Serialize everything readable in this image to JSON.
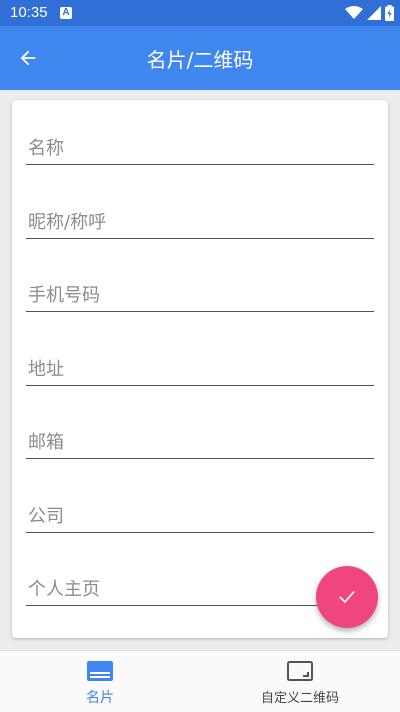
{
  "status_bar": {
    "time": "10:35",
    "notification_letter": "A"
  },
  "app_bar": {
    "title": "名片/二维码",
    "back_icon": "arrow-left-icon"
  },
  "form": {
    "fields": [
      {
        "placeholder": "名称"
      },
      {
        "placeholder": "昵称/称呼"
      },
      {
        "placeholder": "手机号码"
      },
      {
        "placeholder": "地址"
      },
      {
        "placeholder": "邮箱"
      },
      {
        "placeholder": "公司"
      },
      {
        "placeholder": "个人主页"
      }
    ]
  },
  "fab": {
    "icon": "check-icon",
    "color": "#f0467f"
  },
  "bottom_nav": {
    "items": [
      {
        "label": "名片",
        "icon": "card-icon",
        "active": true
      },
      {
        "label": "自定义二维码",
        "icon": "qrcode-frame-icon",
        "active": false
      }
    ]
  },
  "colors": {
    "status_bar": "#2f6fd6",
    "app_bar": "#3f86ee",
    "active_nav": "#3f86ee",
    "inactive_nav": "#555555"
  }
}
